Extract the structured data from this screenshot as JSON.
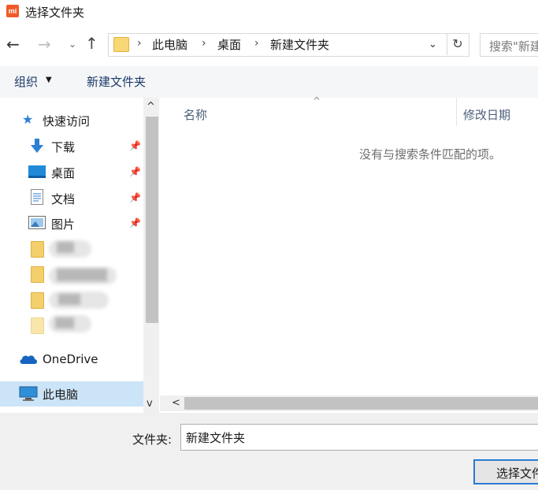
{
  "window": {
    "title": "选择文件夹",
    "app_icon_text": "mi",
    "accent": "#f05a28"
  },
  "address": {
    "breadcrumbs": [
      "此电脑",
      "桌面",
      "新建文件夹"
    ],
    "separator": "›",
    "search_placeholder": "搜索\"新建"
  },
  "nav_buttons": {
    "back": "←",
    "forward": "→",
    "recent": "⌄",
    "up": "↑",
    "dropdown": "⌄",
    "refresh": "↻"
  },
  "toolbar": {
    "organize_label": "组织",
    "organize_caret": "▼",
    "new_folder_label": "新建文件夹"
  },
  "nav": {
    "quick_access": {
      "label": "快速访问",
      "icon": "star-icon"
    },
    "pinned": [
      {
        "label": "下载",
        "icon": "download-arrow-icon"
      },
      {
        "label": "桌面",
        "icon": "desktop-icon"
      },
      {
        "label": "文档",
        "icon": "document-icon"
      },
      {
        "label": "图片",
        "icon": "pictures-icon"
      }
    ],
    "pin_glyph": "📌",
    "onedrive": {
      "label": "OneDrive",
      "icon": "cloud-icon"
    },
    "this_pc": {
      "label": "此电脑",
      "icon": "monitor-icon",
      "selected": true
    },
    "scroll_up": "^",
    "scroll_down": "v"
  },
  "content": {
    "columns": [
      "名称",
      "修改日期"
    ],
    "sort_indicator": "^",
    "empty_message": "没有与搜索条件匹配的项。",
    "hscroll_left": "<"
  },
  "footer": {
    "folder_label": "文件夹:",
    "folder_value": "新建文件夹",
    "select_button_label": "选择文件夹"
  },
  "colors": {
    "selection": "#cce4f7",
    "primary_button_border": "#2b7ad4",
    "folder": "#f4cf6b"
  }
}
